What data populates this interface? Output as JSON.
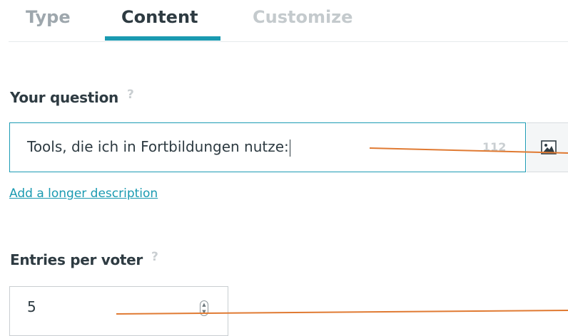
{
  "tabs": [
    {
      "label": "Type"
    },
    {
      "label": "Content"
    },
    {
      "label": "Customize"
    }
  ],
  "question": {
    "label": "Your question",
    "help": "?",
    "value": "Tools, die ich in Fortbildungen nutze:",
    "char_count": "112"
  },
  "add_description_link": "Add a longer description",
  "entries": {
    "label": "Entries per voter",
    "help": "?",
    "value": "5"
  },
  "colors": {
    "accent": "#1a9ab1",
    "annotation_line": "#e07a32"
  },
  "icons": {
    "image_button": "image-icon",
    "spinner": "spinner-arrows-icon"
  }
}
